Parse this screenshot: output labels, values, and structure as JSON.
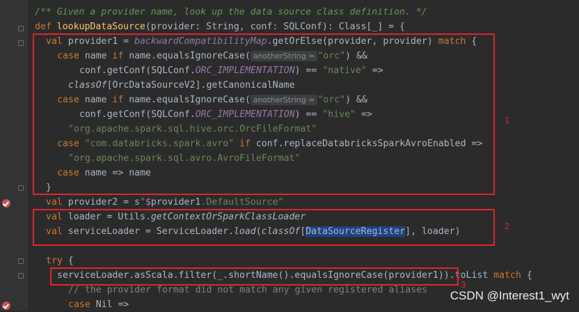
{
  "editor": {
    "lines": {
      "l0": "/** Given a provider name, look up the data source class definition. */",
      "l1_def": "def ",
      "l1_name": "lookupDataSource",
      "l1_rest": "(provider: String, conf: SQLConf): Class[_] = {",
      "l2_val": "val ",
      "l2_a": "provider1 = ",
      "l2_map": "backwardCompatibilityMap",
      "l2_b": ".getOrElse(provider, provider) ",
      "l2_match": "match",
      "l2_c": " {",
      "l3_case": "case ",
      "l3_a": "name ",
      "l3_if": "if ",
      "l3_b": "name.equalsIgnoreCase(",
      "l3_hint": "anotherString =",
      "l3_str": "\"orc\"",
      "l3_c": ") &&",
      "l4_a": "conf.getConf(SQLConf.",
      "l4_const": "ORC_IMPLEMENTATION",
      "l4_b": ") == ",
      "l4_str": "\"native\"",
      "l4_c": " =>",
      "l5_classof": "classOf",
      "l5_a": "[OrcDataSourceV2].getCanonicalName",
      "l6_case": "case ",
      "l6_a": "name ",
      "l6_if": "if ",
      "l6_b": "name.equalsIgnoreCase(",
      "l6_hint": "anotherString =",
      "l6_str": "\"orc\"",
      "l6_c": ") &&",
      "l7_a": "conf.getConf(SQLConf.",
      "l7_const": "ORC_IMPLEMENTATION",
      "l7_b": ") == ",
      "l7_str": "\"hive\"",
      "l7_c": " =>",
      "l8_str": "\"org.apache.spark.sql.hive.orc.OrcFileFormat\"",
      "l9_case": "case ",
      "l9_str": "\"com.databricks.spark.avro\"",
      "l9_if": " if ",
      "l9_a": "conf.replaceDatabricksSparkAvroEnabled =>",
      "l10_str": "\"org.apache.spark.sql.avro.AvroFileFormat\"",
      "l11_case": "case ",
      "l11_a": "name => name",
      "l12": "}",
      "l13_val": "val ",
      "l13_a": "provider2 = s",
      "l13_q": "\"",
      "l13_d": "$",
      "l13_b": "provider1",
      "l13_c": ".DefaultSource\"",
      "l14_val": "val ",
      "l14_a": "loader = Utils.",
      "l14_m": "getContextOrSparkClassLoader",
      "l15_val": "val ",
      "l15_a": "serviceLoader = ServiceLoader.",
      "l15_m": "load",
      "l15_b": "(",
      "l15_classof": "classOf",
      "l15_c": "[",
      "l15_sel": "DataSourceRegister",
      "l15_d": "], loader)",
      "l17_try": "try",
      "l17_a": " {",
      "l18_a": "serviceLoader.asScala.filter(_.shortName().equalsIgnoreCase(provider1)).toList ",
      "l18_match": "match",
      "l18_b": " {",
      "l19": "// the provider format did not match any given registered aliases",
      "l20_case": "case ",
      "l20_a": "Nil =>"
    }
  },
  "annotations": {
    "label1": "1",
    "label2": "2",
    "label3": "3",
    "color": "#e0252c"
  },
  "watermark": "CSDN @Interest1_wyt"
}
